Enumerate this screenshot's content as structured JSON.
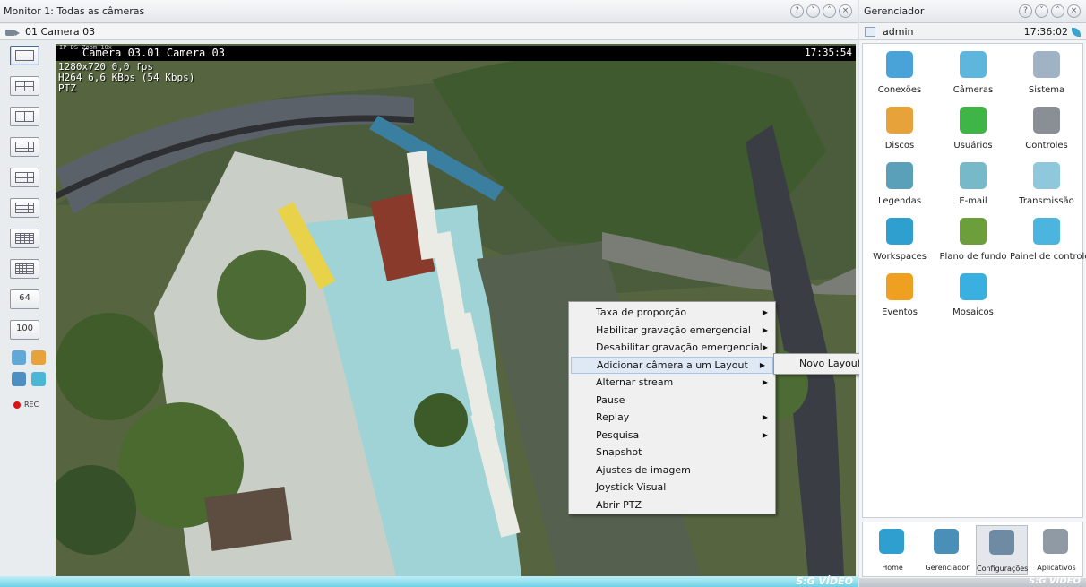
{
  "monitor": {
    "title": "Monitor 1: Todas as câmeras",
    "subtitle": "01 Camera 03",
    "layout_buttons": [
      "64",
      "100"
    ],
    "rec_label": "REC",
    "osd": {
      "tiny": "IP DS Zoom 10x",
      "title": "Camera 03.01 Camera 03",
      "time": "17:35:54",
      "info": "1280x720 0,0 fps\nH264 6,6 KBps (54 Kbps)\nPTZ"
    },
    "brand": "S:G VÍDEO"
  },
  "context_menu": {
    "items": [
      {
        "label": "Taxa de proporção",
        "submenu": true
      },
      {
        "label": "Habilitar gravação emergencial",
        "submenu": true
      },
      {
        "label": "Desabilitar gravação emergencial",
        "submenu": true
      },
      {
        "label": "Adicionar câmera a um Layout",
        "submenu": true,
        "highlighted": true
      },
      {
        "label": "Alternar stream",
        "submenu": true
      },
      {
        "label": "Pause",
        "submenu": false
      },
      {
        "label": "Replay",
        "submenu": true
      },
      {
        "label": "Pesquisa",
        "submenu": true
      },
      {
        "label": "Snapshot",
        "submenu": false
      },
      {
        "label": "Ajustes de imagem",
        "submenu": false
      },
      {
        "label": "Joystick Visual",
        "submenu": false
      },
      {
        "label": "Abrir PTZ",
        "submenu": false
      }
    ],
    "submenu_item": "Novo Layout"
  },
  "manager": {
    "title": "Gerenciador",
    "user": "admin",
    "time": "17:36:02",
    "tiles": [
      {
        "label": "Conexões",
        "icon": "connections-icon",
        "color": "#4aa3d8"
      },
      {
        "label": "Câmeras",
        "icon": "cameras-icon",
        "color": "#5fb6dc"
      },
      {
        "label": "Sistema",
        "icon": "system-icon",
        "color": "#9fb3c4"
      },
      {
        "label": "Discos",
        "icon": "disks-icon",
        "color": "#e8a23a"
      },
      {
        "label": "Usuários",
        "icon": "users-icon",
        "color": "#3fb548"
      },
      {
        "label": "Controles",
        "icon": "controls-icon",
        "color": "#8a8f96"
      },
      {
        "label": "Legendas",
        "icon": "captions-icon",
        "color": "#5aa0b8"
      },
      {
        "label": "E-mail",
        "icon": "email-icon",
        "color": "#78b9c9"
      },
      {
        "label": "Transmissão",
        "icon": "transmission-icon",
        "color": "#8fc7dc"
      },
      {
        "label": "Workspaces",
        "icon": "workspaces-icon",
        "color": "#2f9fd0"
      },
      {
        "label": "Plano de fundo",
        "icon": "background-icon",
        "color": "#6c9f3c"
      },
      {
        "label": "Painel de controle",
        "icon": "control-panel-icon",
        "color": "#4bb5e0"
      },
      {
        "label": "Eventos",
        "icon": "events-icon",
        "color": "#f0a020"
      },
      {
        "label": "Mosaicos",
        "icon": "mosaics-icon",
        "color": "#3ab0e0"
      }
    ],
    "dock": [
      {
        "label": "Home",
        "icon": "home-icon",
        "color": "#2f9fd0"
      },
      {
        "label": "Gerenciador",
        "icon": "manager-icon",
        "color": "#4a8fb8"
      },
      {
        "label": "Configurações",
        "icon": "settings-icon",
        "color": "#6f8aa3"
      },
      {
        "label": "Aplicativos",
        "icon": "apps-icon",
        "color": "#8f9aa4"
      }
    ],
    "brand": "S:G VÍDEO"
  }
}
